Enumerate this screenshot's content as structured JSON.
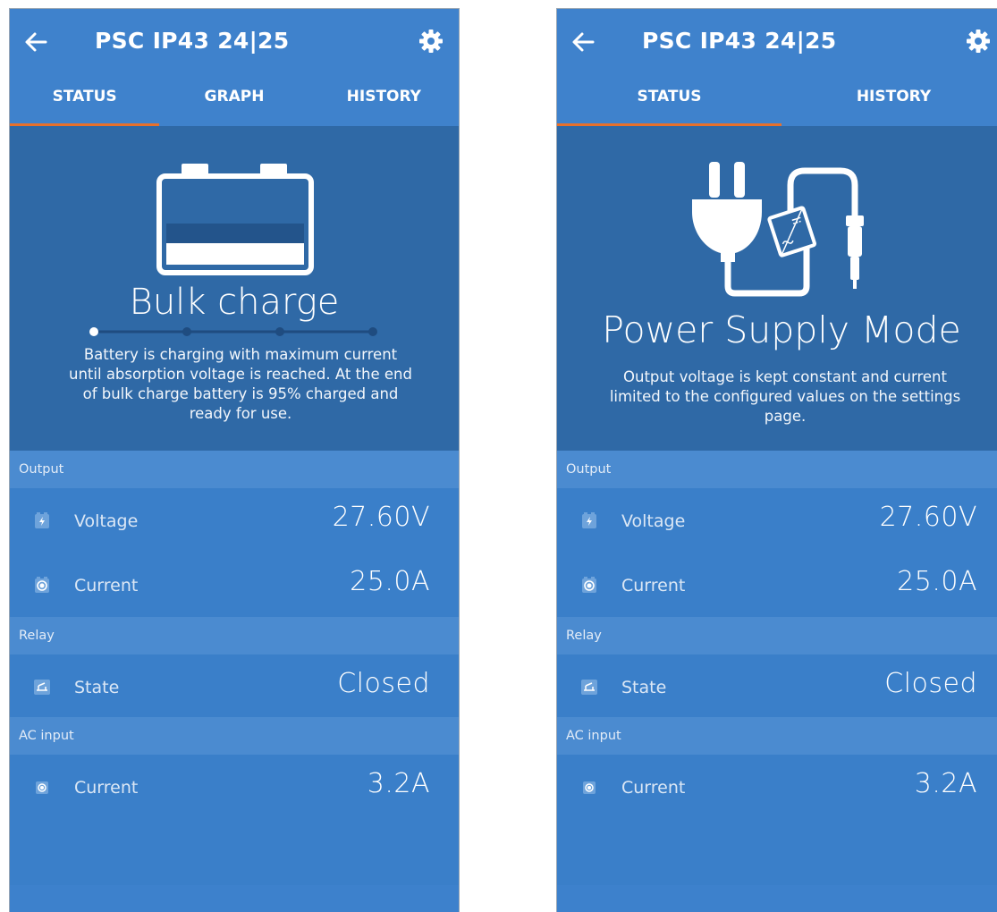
{
  "screens": [
    {
      "header": {
        "title": "PSC IP43 24|25"
      },
      "tabs": [
        "STATUS",
        "GRAPH",
        "HISTORY"
      ],
      "active_tab": "STATUS",
      "hero": {
        "state_title": "Bulk charge",
        "description": "Battery is charging with maximum current until absorption voltage is reached. At the end of bulk charge battery is 95% charged and ready for use.",
        "stage_steps": 4,
        "active_step": 1
      },
      "sections": [
        {
          "title": "Output",
          "rows": [
            {
              "icon": "battery-bolt-icon",
              "label": "Voltage",
              "value": "27.60V"
            },
            {
              "icon": "current-icon",
              "label": "Current",
              "value": "25.0A"
            }
          ]
        },
        {
          "title": "Relay",
          "rows": [
            {
              "icon": "relay-icon",
              "label": "State",
              "value": "Closed"
            }
          ]
        },
        {
          "title": "AC input",
          "rows": [
            {
              "icon": "ac-current-icon",
              "label": "Current",
              "value": "3.2A"
            }
          ]
        }
      ]
    },
    {
      "header": {
        "title": "PSC IP43 24|25"
      },
      "tabs": [
        "STATUS",
        "HISTORY"
      ],
      "active_tab": "STATUS",
      "hero": {
        "state_title": "Power Supply Mode",
        "description": "Output voltage is kept constant and current limited to the configured values on the settings page."
      },
      "sections": [
        {
          "title": "Output",
          "rows": [
            {
              "icon": "battery-bolt-icon",
              "label": "Voltage",
              "value": "27.60V"
            },
            {
              "icon": "current-icon",
              "label": "Current",
              "value": "25.0A"
            }
          ]
        },
        {
          "title": "Relay",
          "rows": [
            {
              "icon": "relay-icon",
              "label": "State",
              "value": "Closed"
            }
          ]
        },
        {
          "title": "AC input",
          "rows": [
            {
              "icon": "ac-current-icon",
              "label": "Current",
              "value": "3.2A"
            }
          ]
        }
      ]
    }
  ],
  "colors": {
    "header_bg": "#3f82cc",
    "hero_bg": "#2f69a6",
    "section_bg": "#4b8bd0",
    "row_bg": "#3a7fc9",
    "tab_indicator": "#e8702a"
  }
}
